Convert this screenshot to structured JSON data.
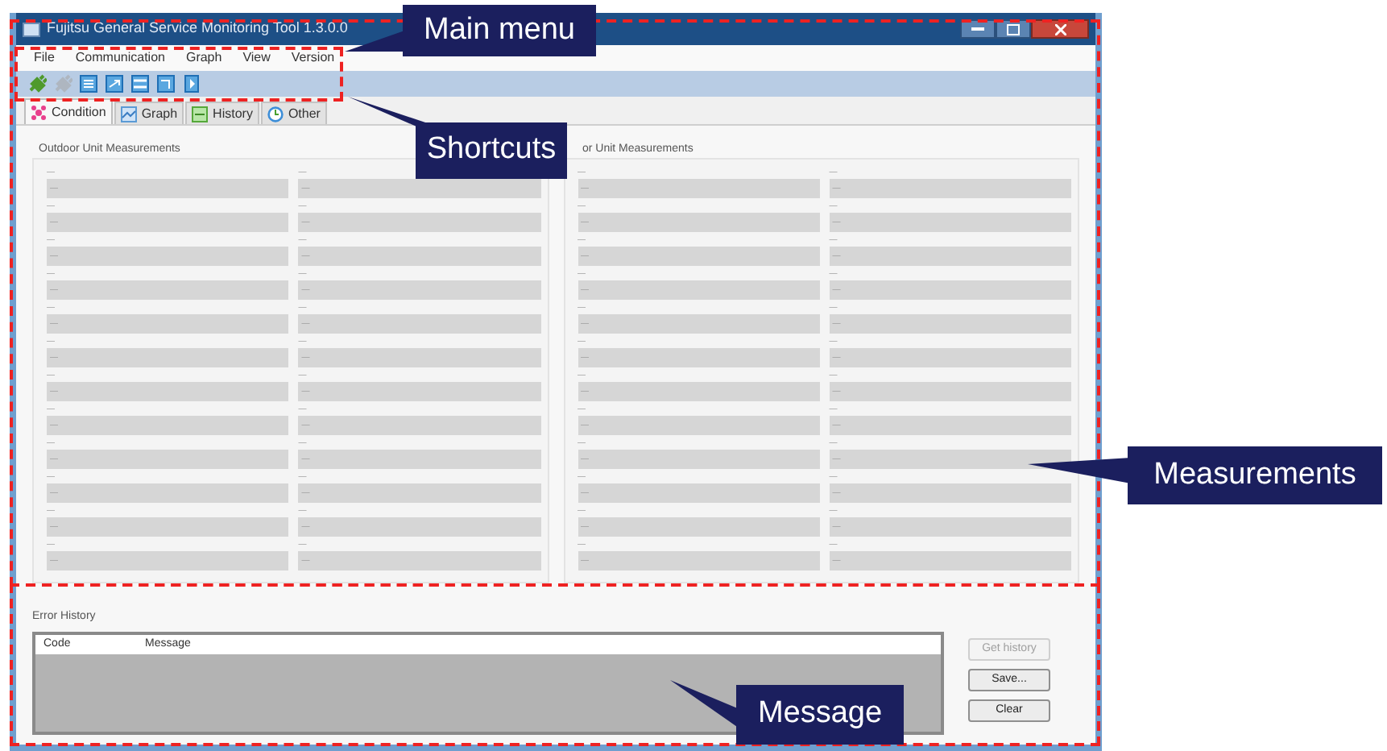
{
  "window": {
    "title": "Fujitsu General Service Monitoring Tool 1.3.0.0"
  },
  "menu": [
    "File",
    "Communication",
    "Graph",
    "View",
    "Version"
  ],
  "toolbar": [
    {
      "kind": "plug",
      "disabled": false
    },
    {
      "kind": "plug",
      "disabled": true
    },
    {
      "kind": "grid",
      "disabled": false
    },
    {
      "kind": "export",
      "disabled": false
    },
    {
      "kind": "lines",
      "disabled": false
    },
    {
      "kind": "import",
      "disabled": false
    },
    {
      "kind": "play",
      "disabled": false
    }
  ],
  "tabs": [
    {
      "label": "Condition",
      "kind": "condition",
      "selected": true
    },
    {
      "label": "Graph",
      "kind": "graph",
      "selected": false
    },
    {
      "label": "History",
      "kind": "history",
      "selected": false
    },
    {
      "label": "Other",
      "kind": "other",
      "selected": false
    }
  ],
  "groups": [
    {
      "title": "Outdoor Unit Measurements",
      "columns": [
        [
          {
            "label": "—",
            "value": "—"
          },
          {
            "label": "—",
            "value": "—"
          },
          {
            "label": "—",
            "value": "—"
          },
          {
            "label": "—",
            "value": "—"
          },
          {
            "label": "—",
            "value": "—"
          },
          {
            "label": "—",
            "value": "—"
          },
          {
            "label": "—",
            "value": "—"
          },
          {
            "label": "—",
            "value": "—"
          },
          {
            "label": "—",
            "value": "—"
          },
          {
            "label": "—",
            "value": "—"
          },
          {
            "label": "—",
            "value": "—"
          },
          {
            "label": "—",
            "value": "—"
          }
        ],
        [
          {
            "label": "—",
            "value": "—"
          },
          {
            "label": "—",
            "value": "—"
          },
          {
            "label": "—",
            "value": "—"
          },
          {
            "label": "—",
            "value": "—"
          },
          {
            "label": "—",
            "value": "—"
          },
          {
            "label": "—",
            "value": "—"
          },
          {
            "label": "—",
            "value": "—"
          },
          {
            "label": "—",
            "value": "—"
          },
          {
            "label": "—",
            "value": "—"
          },
          {
            "label": "—",
            "value": "—"
          },
          {
            "label": "—",
            "value": "—"
          },
          {
            "label": "—",
            "value": "—"
          }
        ]
      ]
    },
    {
      "title": "or Unit Measurements",
      "columns": [
        [
          {
            "label": "—",
            "value": "—"
          },
          {
            "label": "—",
            "value": "—"
          },
          {
            "label": "—",
            "value": "—"
          },
          {
            "label": "—",
            "value": "—"
          },
          {
            "label": "—",
            "value": "—"
          },
          {
            "label": "—",
            "value": "—"
          },
          {
            "label": "—",
            "value": "—"
          },
          {
            "label": "—",
            "value": "—"
          },
          {
            "label": "—",
            "value": "—"
          },
          {
            "label": "—",
            "value": "—"
          },
          {
            "label": "—",
            "value": "—"
          },
          {
            "label": "—",
            "value": "—"
          }
        ],
        [
          {
            "label": "—",
            "value": "—"
          },
          {
            "label": "—",
            "value": "—"
          },
          {
            "label": "—",
            "value": "—"
          },
          {
            "label": "—",
            "value": "—"
          },
          {
            "label": "—",
            "value": "—"
          },
          {
            "label": "—",
            "value": "—"
          },
          {
            "label": "—",
            "value": "—"
          },
          {
            "label": "—",
            "value": "—"
          },
          {
            "label": "—",
            "value": "—"
          },
          {
            "label": "—",
            "value": "—"
          },
          {
            "label": "—",
            "value": "—"
          },
          {
            "label": "—",
            "value": "—"
          }
        ]
      ]
    }
  ],
  "error_history": {
    "title": "Error History",
    "columns": [
      "Code",
      "Message"
    ]
  },
  "buttons": [
    {
      "label": "Get history",
      "disabled": true
    },
    {
      "label": "Save...",
      "disabled": false
    },
    {
      "label": "Clear",
      "disabled": false
    }
  ],
  "annotations": [
    {
      "text": "Main menu",
      "kind": "main_menu"
    },
    {
      "text": "Shortcuts",
      "kind": "shortcuts"
    },
    {
      "text": "Measurements",
      "kind": "measurements"
    },
    {
      "text": "Message",
      "kind": "message"
    }
  ]
}
